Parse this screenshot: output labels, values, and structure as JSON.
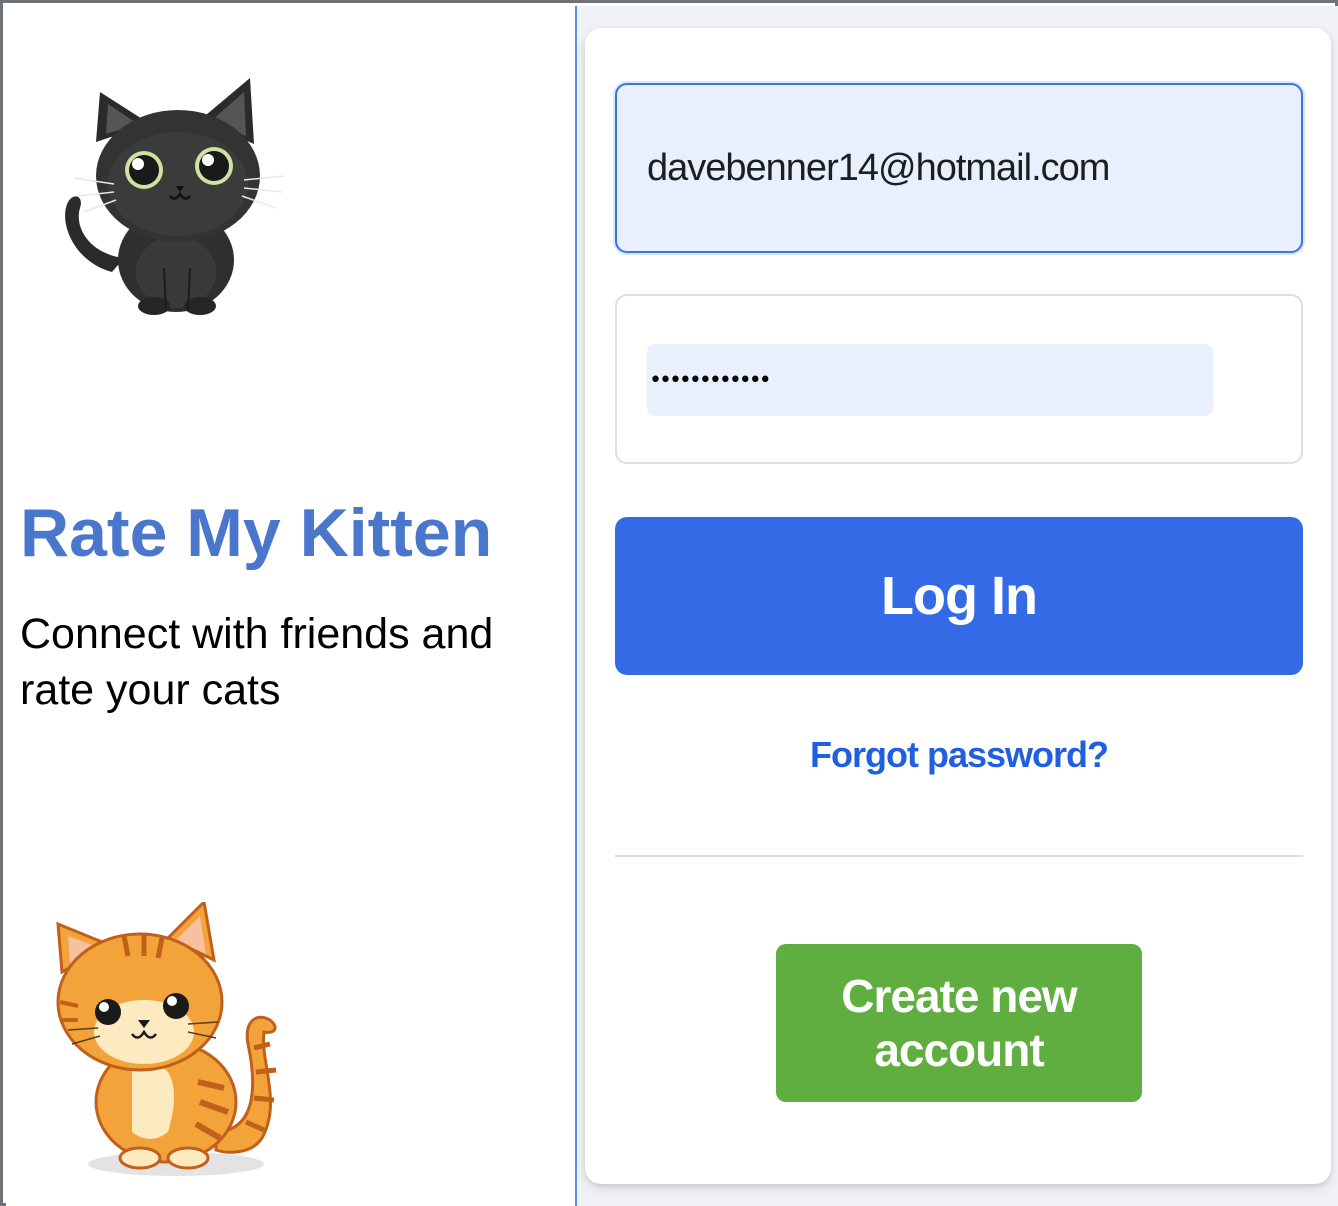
{
  "brand": {
    "title": "Rate My Kitten",
    "tagline": "Connect with friends and rate your cats",
    "title_color": "#4a76cc"
  },
  "images": {
    "top_cat": "black-kitten-illustration",
    "bottom_cat": "orange-tabby-kitten-illustration"
  },
  "login": {
    "email_value": "davebenner14@hotmail.com",
    "password_value": "••••••••••••",
    "login_label": "Log In",
    "forgot_label": "Forgot password?",
    "create_label": "Create new account"
  },
  "colors": {
    "primary": "#356ae6",
    "link": "#1f5fe0",
    "success": "#5fae3f",
    "autofill_bg": "#e8f0fe"
  }
}
